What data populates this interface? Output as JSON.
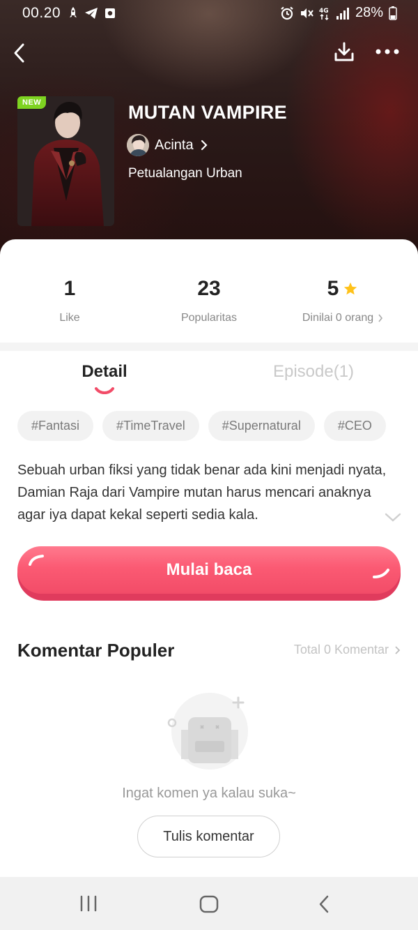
{
  "status_bar": {
    "time": "00.20",
    "battery": "28%",
    "left_icons": [
      "rocket-icon",
      "telegram-icon",
      "camera-notification-icon"
    ],
    "right_icons": [
      "alarm-icon",
      "mute-icon",
      "4g-data-icon",
      "signal-icon",
      "battery-icon"
    ]
  },
  "top_nav": {
    "back_icon": "chevron-left-icon",
    "download_icon": "download-icon",
    "more_icon": "more-horizontal-icon"
  },
  "book": {
    "badge": "NEW",
    "title": "MUTAN VAMPIRE",
    "author": "Acinta",
    "genre": "Petualangan Urban"
  },
  "stats": [
    {
      "value": "1",
      "label": "Like"
    },
    {
      "value": "23",
      "label": "Popularitas"
    },
    {
      "value": "5",
      "label": "Dinilai 0 orang",
      "rating": 5
    }
  ],
  "tabs": [
    {
      "label": "Detail",
      "active": true
    },
    {
      "label": "Episode(1)",
      "active": false
    }
  ],
  "tags": [
    "#Fantasi",
    "#TimeTravel",
    "#Supernatural",
    "#CEO"
  ],
  "synopsis": "Sebuah urban fiksi yang tidak benar ada kini menjadi nyata, Damian Raja dari Vampire mutan harus mencari anaknya agar iya dapat kekal seperti sedia kala.",
  "start_button": {
    "label": "Mulai baca"
  },
  "comments": {
    "title": "Komentar Populer",
    "total": "Total 0 Komentar",
    "empty_text": "Ingat komen ya kalau suka~",
    "write_button": "Tulis komentar"
  },
  "colors": {
    "accent": "#f9566f",
    "star": "#ffc21a",
    "new_badge": "#7ed321"
  }
}
